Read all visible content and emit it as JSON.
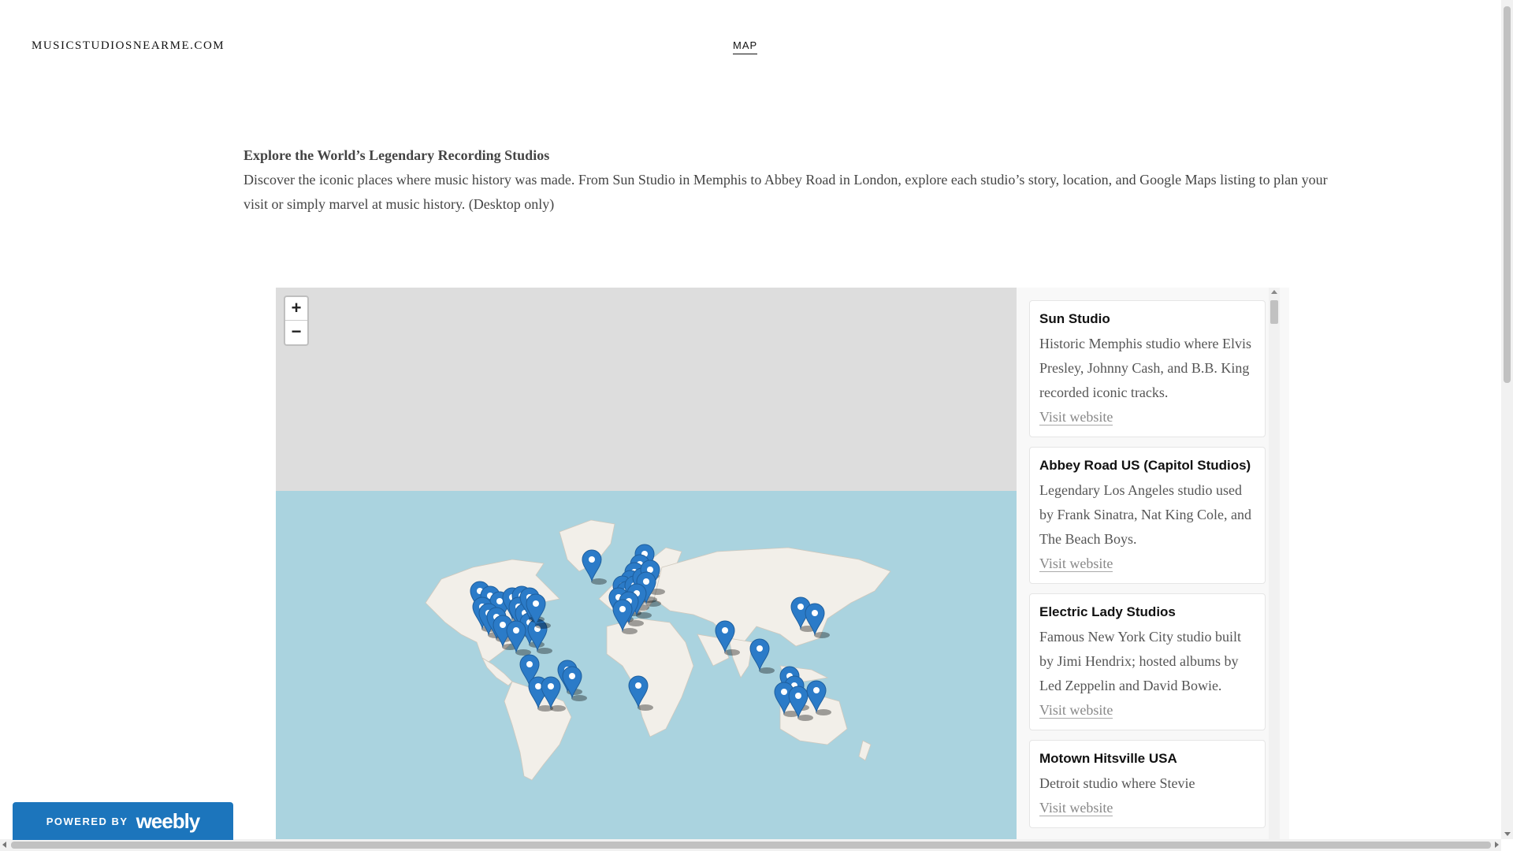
{
  "header": {
    "site_title": "MUSICSTUDIOSNEARME.COM",
    "nav": [
      {
        "label": "MAP"
      }
    ]
  },
  "intro": {
    "heading": "Explore the World’s Legendary Recording Studios",
    "body": "Discover the iconic places where music history was made. From Sun Studio in Memphis to Abbey Road in London, explore each studio’s story, location, and Google Maps listing to plan your visit or simply marvel at music history. (Desktop only)"
  },
  "map": {
    "zoom_in_label": "+",
    "zoom_out_label": "−",
    "marker_color": "#2b7bc8",
    "water_color": "#aad3df",
    "land_color": "#f2efe9",
    "unloaded_color": "#dddddd"
  },
  "studios": [
    {
      "name": "Sun Studio",
      "description": "Historic Memphis studio where Elvis Presley, Johnny Cash, and B.B. King recorded iconic tracks.",
      "link_label": "Visit website"
    },
    {
      "name": "Abbey Road US (Capitol Studios)",
      "description": "Legendary Los Angeles studio used by Frank Sinatra, Nat King Cole, and The Beach Boys.",
      "link_label": "Visit website"
    },
    {
      "name": "Electric Lady Studios",
      "description": "Famous New York City studio built by Jimi Hendrix; hosted albums by Led Zeppelin and David Bowie.",
      "link_label": "Visit website"
    },
    {
      "name": "Motown Hitsville USA",
      "description": "Detroit studio where Stevie",
      "link_label": "Visit website"
    }
  ],
  "footer_badge": {
    "powered_by": "POWERED BY",
    "brand": "weebly"
  }
}
